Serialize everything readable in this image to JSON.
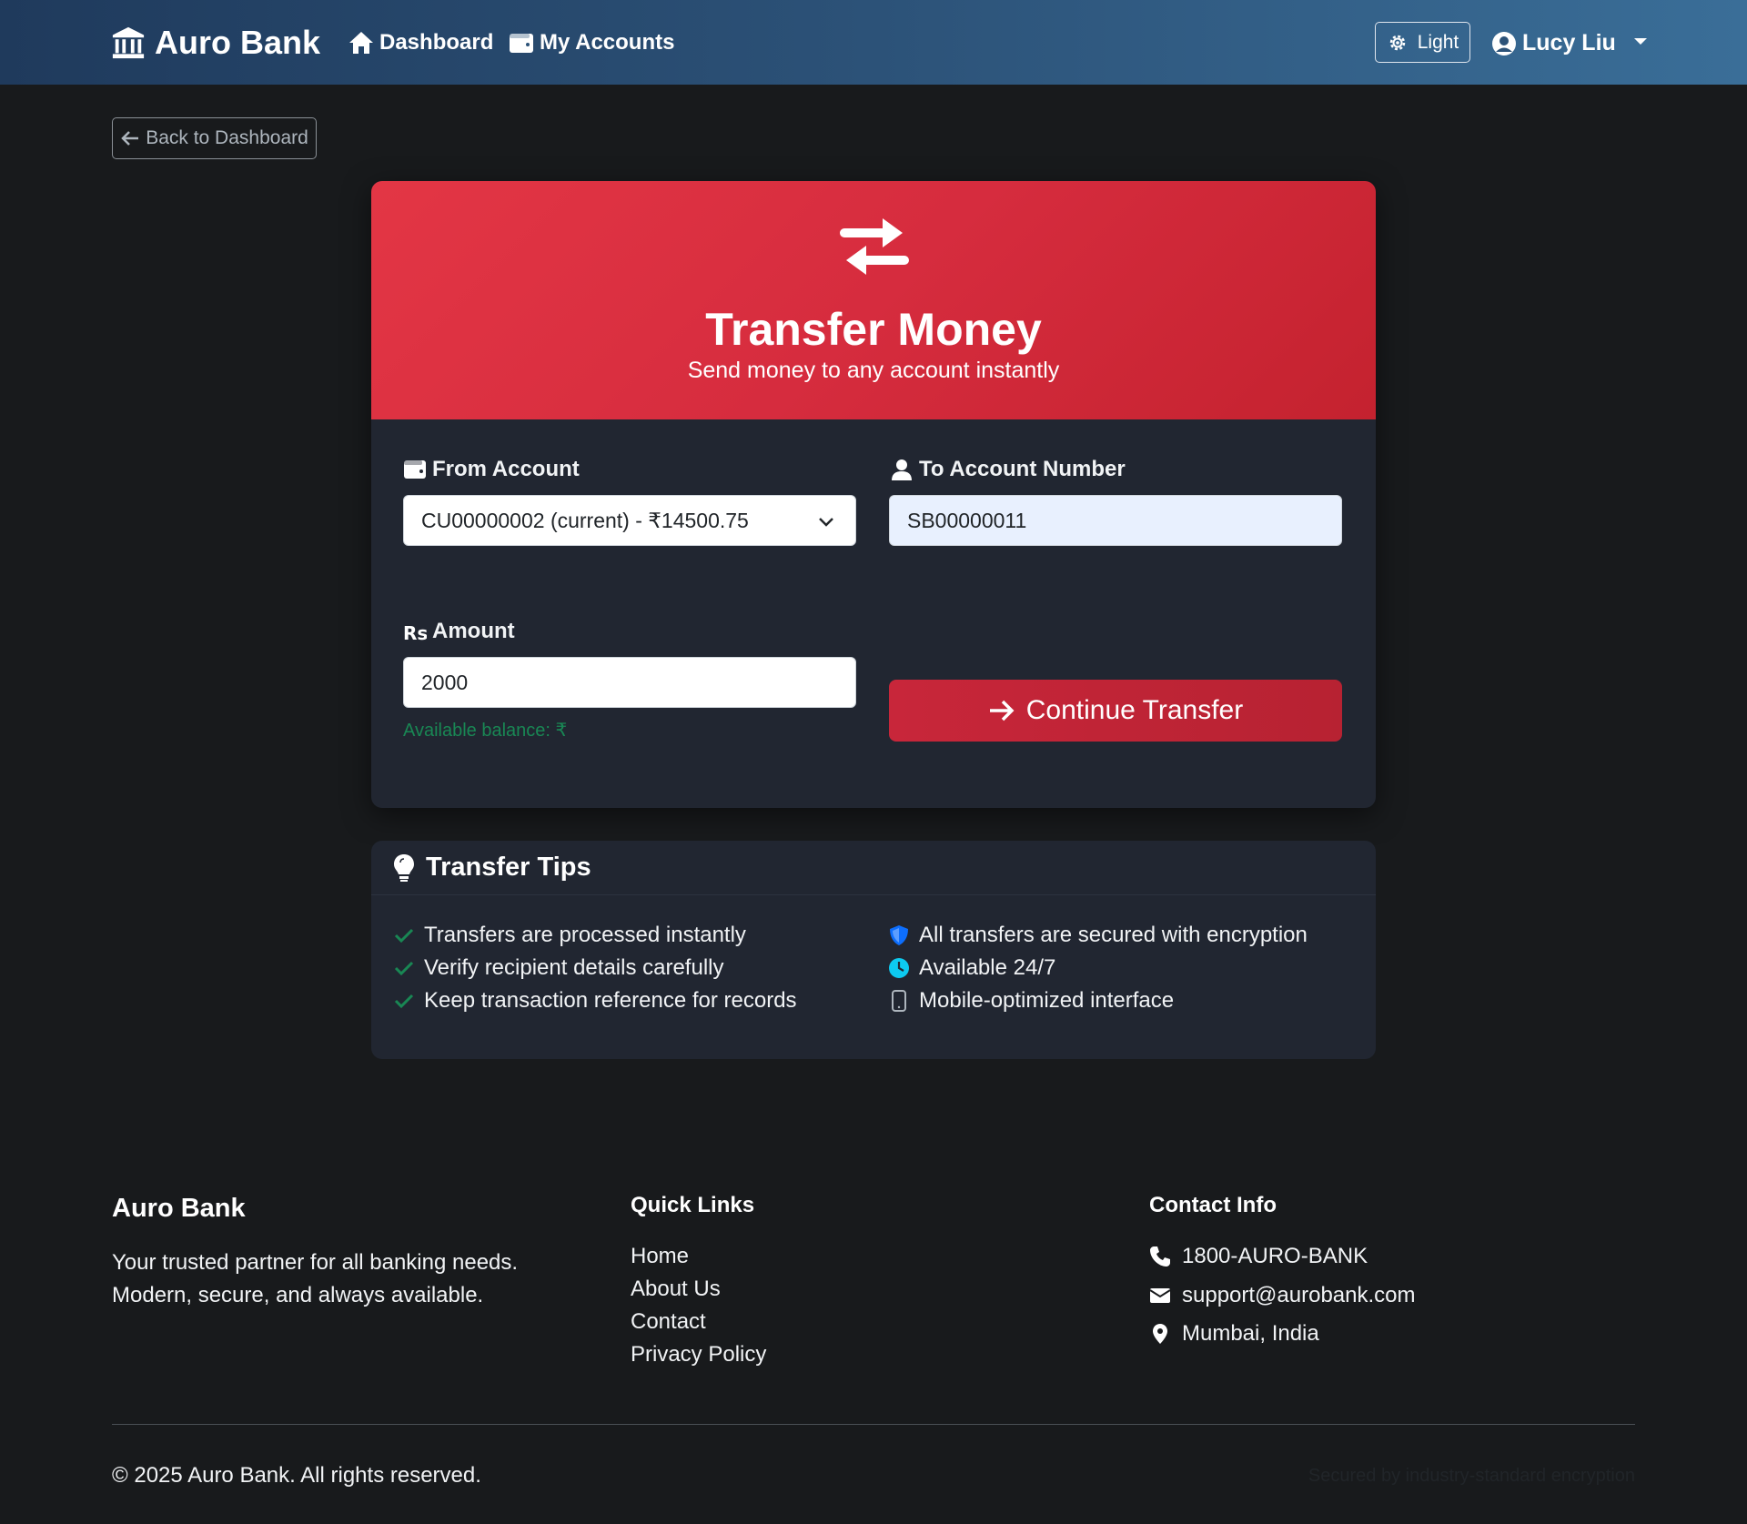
{
  "navbar": {
    "brand": "Auro Bank",
    "links": {
      "dashboard": "Dashboard",
      "accounts": "My Accounts"
    },
    "theme_label": "Light",
    "user_name": "Lucy Liu"
  },
  "back_label": "Back to Dashboard",
  "transfer": {
    "title": "Transfer Money",
    "subtitle": "Send money to any account instantly",
    "from_label": "From Account",
    "from_value": "CU00000002 (current) - ₹14500.75",
    "to_label": "To Account Number",
    "to_value": "SB00000011",
    "amount_label": "Amount",
    "amount_value": "2000",
    "balance_text": "Available balance: ₹",
    "continue_label": "Continue Transfer"
  },
  "tips": {
    "title": "Transfer Tips",
    "left": [
      "Transfers are processed instantly",
      "Verify recipient details carefully",
      "Keep transaction reference for records"
    ],
    "right": [
      "All transfers are secured with encryption",
      "Available 24/7",
      "Mobile-optimized interface"
    ]
  },
  "footer": {
    "brand": "Auro Bank",
    "tagline_1": "Your trusted partner for all banking needs.",
    "tagline_2": "Modern, secure, and always available.",
    "quick_title": "Quick Links",
    "quick_links": [
      "Home",
      "About Us",
      "Contact",
      "Privacy Policy"
    ],
    "contact_title": "Contact Info",
    "phone": "1800-AURO-BANK",
    "email": "support@aurobank.com",
    "location": "Mumbai, India",
    "copyright": "© 2025 Auro Bank. All rights reserved.",
    "secured": "Secured by industry-standard encryption"
  },
  "colors": {
    "accent_red": "#dc3545",
    "success_green": "#198754",
    "navbar_blue": "#2c5278"
  }
}
